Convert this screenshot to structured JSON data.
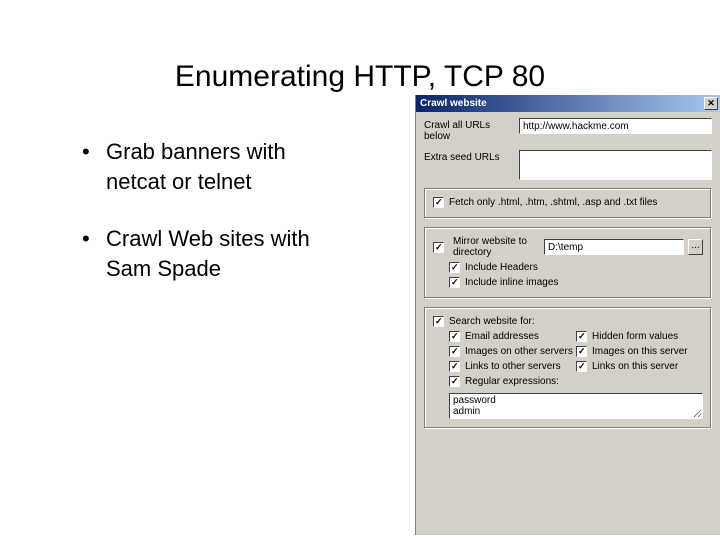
{
  "title": "Enumerating HTTP, TCP 80",
  "bullets": [
    "Grab banners with netcat or telnet",
    "Crawl Web sites with Sam Spade"
  ],
  "dialog": {
    "title": "Crawl website",
    "url_label": "Crawl all URLs below",
    "url_value": "http://www.hackme.com",
    "seed_label": "Extra seed URLs",
    "seed_value": "",
    "fetch_only_label": "Fetch only .html, .htm, .shtml, .asp and .txt files",
    "mirror_label": "Mirror website to directory",
    "mirror_path": "D:\\temp",
    "browse_label": "...",
    "include_headers_label": "Include Headers",
    "include_images_label": "Include inline images",
    "search_label": "Search website for:",
    "opts": {
      "email": "Email addresses",
      "hidden": "Hidden form values",
      "img_other": "Images on other servers",
      "img_this": "Images on this server",
      "links_other": "Links to other servers",
      "links_this": "Links on this server",
      "regex": "Regular expressions:"
    },
    "regex_value": "password\nadmin"
  }
}
